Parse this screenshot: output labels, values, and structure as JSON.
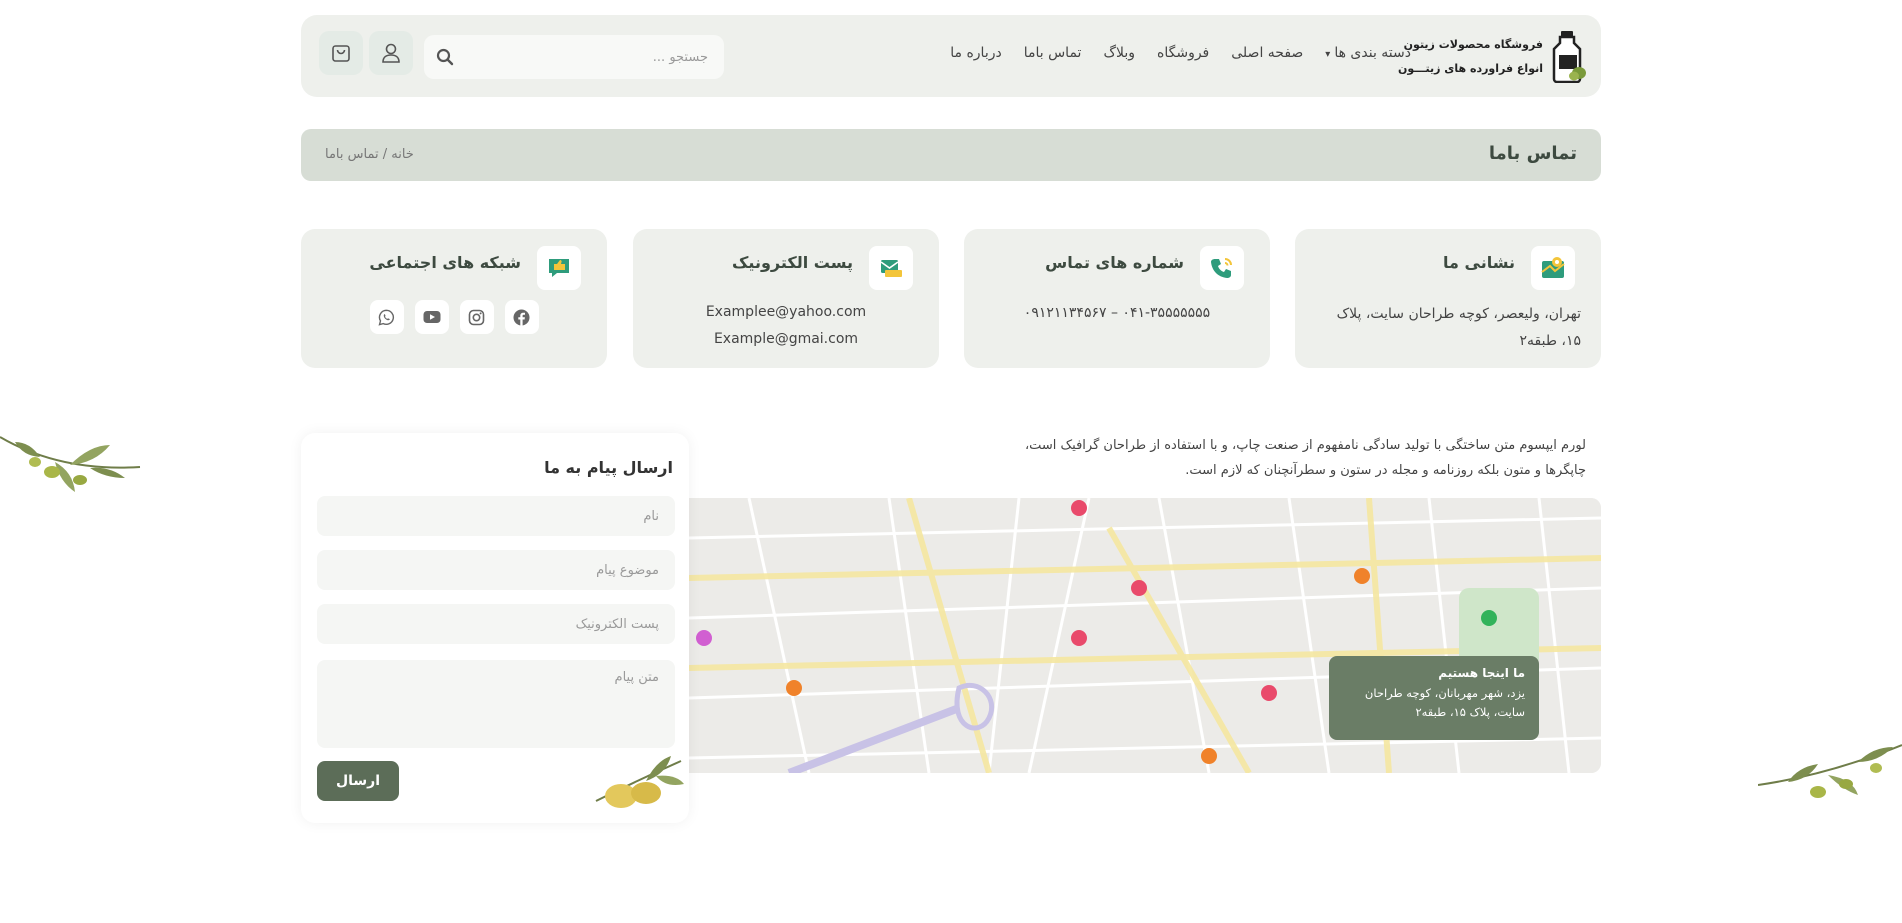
{
  "header": {
    "logo_title": "فروشگاه محصولات زیتون",
    "logo_subtitle": "انواع فراورده های زیتـــون",
    "nav": [
      {
        "label": "دسته بندی ها",
        "has_dropdown": true
      },
      {
        "label": "صفحه اصلی"
      },
      {
        "label": "فروشگاه"
      },
      {
        "label": "وبلاگ"
      },
      {
        "label": "تماس باما"
      },
      {
        "label": "درباره ما"
      }
    ],
    "search_placeholder": "جستجو ...",
    "icons": {
      "search": "search-icon",
      "user": "user-icon",
      "cart": "shopping-bag-icon"
    }
  },
  "title_bar": {
    "title": "تماس باما",
    "breadcrumb": "خانه / تماس باما"
  },
  "cards": {
    "address": {
      "title": "نشانی ما",
      "body": "تهران، ولیعصر، کوچه طراحان سایت، پلاک ۱۵، طبقه۲",
      "icon": "map-icon"
    },
    "phone": {
      "title": "شماره های تماس",
      "body": "۰۴۱-۳۵۵۵۵۵۵۵ – ۰۹۱۲۱۱۳۴۵۶۷",
      "icon": "phone-icon"
    },
    "email": {
      "title": "پست الکترونیک",
      "lines": [
        "Examplee@yahoo.com",
        "Example@gmai.com"
      ],
      "icon": "mail-icon"
    },
    "social": {
      "title": "شبکه های اجتماعی",
      "icon": "chat-like-icon",
      "links": [
        "facebook-icon",
        "instagram-icon",
        "youtube-icon",
        "whatsapp-icon"
      ]
    }
  },
  "description": "لورم ایپسوم متن ساختگی با تولید سادگی نامفهوم از صنعت چاپ، و با استفاده از طراحان گرافیک است، چاپگرها و متون بلکه روزنامه و مجله در ستون و سطرآنچنان که لازم است.",
  "map": {
    "tooltip_title": "ما اینجا هستیم",
    "tooltip_text": "یزد، شهر مهربانان، کوچه طراحان سایت، پلاک ۱۵، طبقه۲"
  },
  "form": {
    "title": "ارسال پیام به ما",
    "name_placeholder": "نام",
    "subject_placeholder": "موضوع پیام",
    "email_placeholder": "پست الکترونیک",
    "message_placeholder": "متن پیام",
    "submit_label": "ارسال"
  },
  "colors": {
    "accent": "#5c6d58",
    "header_bg": "#eef0ec",
    "title_bar_bg": "#d7ddd5",
    "tooltip_bg": "#6a7d66"
  }
}
